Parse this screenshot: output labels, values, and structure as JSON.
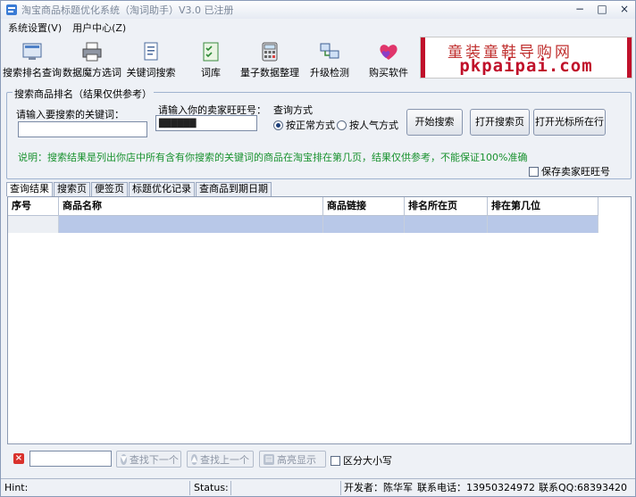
{
  "window": {
    "title": "淘宝商品标题优化系统（淘词助手）V3.0  已注册",
    "controls": {
      "minimize": "−",
      "maximize": "□",
      "close": "×"
    }
  },
  "menu": [
    "系统设置(V)",
    "用户中心(Z)"
  ],
  "toolbar": [
    {
      "label": "搜索排名查询",
      "icon": "search-rank-icon"
    },
    {
      "label": "数据魔方选词",
      "icon": "printer-icon"
    },
    {
      "label": "关键词搜索",
      "icon": "document-icon"
    },
    {
      "label": "词库",
      "icon": "checklist-icon"
    },
    {
      "label": "量子数据整理",
      "icon": "calculator-icon"
    },
    {
      "label": "升级检测",
      "icon": "network-icon"
    },
    {
      "label": "购买软件",
      "icon": "hearts-icon"
    }
  ],
  "banner": {
    "top": "童装童鞋导购网",
    "bottom": "pkpaipai.com"
  },
  "search": {
    "group_title": "搜索商品排名（结果仅供参考）",
    "keyword_label": "请输入要搜索的关键词：",
    "keyword_value": "",
    "seller_label": "请输入你的卖家旺旺号：",
    "seller_value": "██████",
    "mode_label": "查询方式",
    "modes": [
      {
        "label": "按正常方式",
        "checked": true
      },
      {
        "label": "按人气方式",
        "checked": false
      }
    ],
    "buttons": [
      "开始搜索",
      "打开搜索页",
      "打开光标所在行"
    ],
    "note": "说明：搜索结果是列出你店中所有含有你搜索的关键词的商品在淘宝排在第几页，结果仅供参考，不能保证100%准确",
    "save_label": "保存卖家旺旺号"
  },
  "tabs": [
    "查询结果",
    "搜索页",
    "便签页",
    "标题优化记录",
    "查商品到期日期"
  ],
  "table": {
    "columns": [
      "序号",
      "商品名称",
      "商品链接",
      "排名所在页",
      "排在第几位"
    ]
  },
  "findbar": {
    "next": "查找下一个",
    "prev": "查找上一个",
    "highlight": "高亮显示",
    "case": "区分大小写"
  },
  "status": {
    "hint": "Hint:",
    "status": "Status:",
    "developer": "开发者：陈华军",
    "phone": "联系电话：13950324972",
    "qq": "联系QQ:68393420"
  }
}
